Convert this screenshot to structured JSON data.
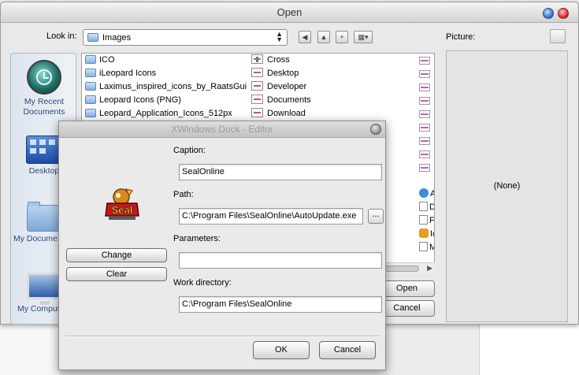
{
  "open_dialog": {
    "title": "Open",
    "look_in_label": "Look in:",
    "look_in_value": "Images",
    "picture_label": "Picture:",
    "picture_preview": "(None)",
    "places": [
      {
        "label": "My Recent Documents",
        "icon": "recent-icon"
      },
      {
        "label": "Desktop",
        "icon": "desktop-icon"
      },
      {
        "label": "My Docume",
        "icon": "my-documents-icon"
      },
      {
        "label": "My Comput",
        "icon": "my-computer-icon"
      }
    ],
    "folders": [
      "ICO",
      "iLeopard Icons",
      "Laximus_inspired_icons_by_RaatsGui",
      "Leopard Icons (PNG)",
      "Leopard_Application_Icons_512px"
    ],
    "files": [
      "Cross",
      "Desktop",
      "Developer",
      "Documents",
      "Download"
    ],
    "col3_fragments": [
      "A",
      "D",
      "F",
      "Ic",
      "M"
    ],
    "open_button": "Open",
    "cancel_button": "Cancel"
  },
  "editor": {
    "title": "XWindows Dock - Editor",
    "caption_label": "Caption:",
    "caption_value": "SealOnline",
    "path_label": "Path:",
    "path_value": "C:\\Program Files\\SealOnline\\AutoUpdate.exe",
    "browse_label": "...",
    "parameters_label": "Parameters:",
    "parameters_value": "",
    "workdir_label": "Work directory:",
    "workdir_value": "C:\\Program Files\\SealOnline",
    "change_button": "Change",
    "clear_button": "Clear",
    "ok_button": "OK",
    "cancel_button": "Cancel",
    "icon": "seal-online-icon"
  }
}
